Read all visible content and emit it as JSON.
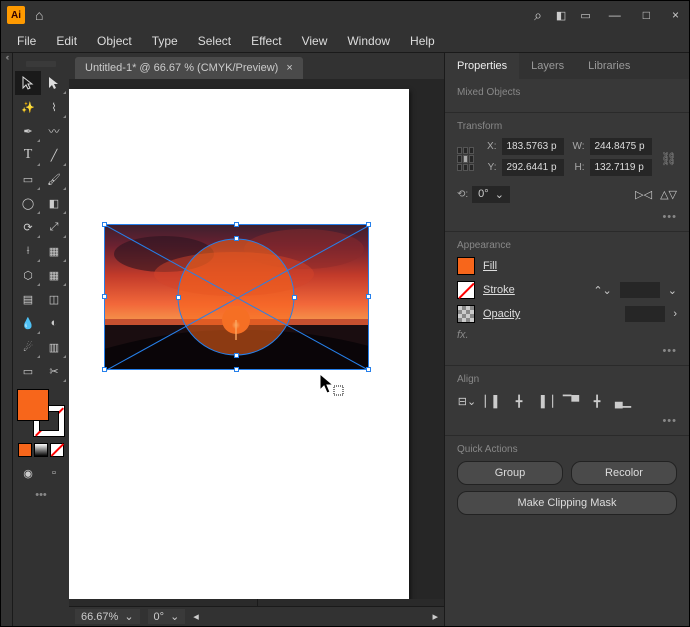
{
  "menu": {
    "file": "File",
    "edit": "Edit",
    "object": "Object",
    "type": "Type",
    "select": "Select",
    "effect": "Effect",
    "view": "View",
    "window": "Window",
    "help": "Help"
  },
  "logo": "Ai",
  "doc": {
    "title": "Untitled-1* @ 66.67 % (CMYK/Preview)",
    "close": "×"
  },
  "status": {
    "zoom": "66.67%",
    "angle": "0°"
  },
  "panel": {
    "tabs": {
      "properties": "Properties",
      "layers": "Layers",
      "libraries": "Libraries"
    },
    "seltype": "Mixed Objects",
    "transform": {
      "title": "Transform",
      "x_lbl": "X:",
      "y_lbl": "Y:",
      "w_lbl": "W:",
      "h_lbl": "H:",
      "x": "183.5763 p",
      "y": "292.6441 p",
      "w": "244.8475 p",
      "h": "132.7119 p",
      "rot_lbl": "⟲:",
      "rot": "0°"
    },
    "appearance": {
      "title": "Appearance",
      "fill": "Fill",
      "stroke": "Stroke",
      "opacity": "Opacity",
      "fx": "fx."
    },
    "align": {
      "title": "Align"
    },
    "quick": {
      "title": "Quick Actions",
      "group": "Group",
      "recolor": "Recolor",
      "mask": "Make Clipping Mask"
    }
  },
  "colors": {
    "fill": "#f7661b"
  },
  "more": "•••",
  "win": {
    "min": "—",
    "max": "□",
    "close": "×"
  }
}
